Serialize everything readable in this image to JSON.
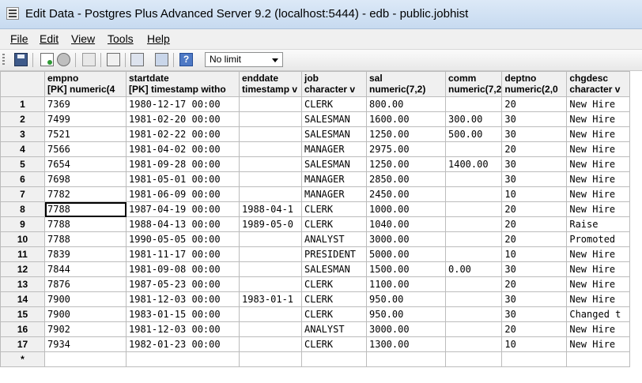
{
  "window": {
    "title": "Edit Data - Postgres Plus Advanced Server 9.2 (localhost:5444) - edb - public.jobhist"
  },
  "menu": [
    {
      "label": "File"
    },
    {
      "label": "Edit"
    },
    {
      "label": "View"
    },
    {
      "label": "Tools"
    },
    {
      "label": "Help"
    }
  ],
  "toolbar": {
    "icons": [
      "save-icon",
      "add-row-icon",
      "refresh-icon",
      "copy-icon",
      "paste-icon",
      "delete-icon",
      "sort-icon",
      "filter-icon",
      "help-icon"
    ],
    "limit_value": "No limit"
  },
  "grid": {
    "columns": [
      {
        "name": "empno",
        "type": "[PK] numeric(4"
      },
      {
        "name": "startdate",
        "type": "[PK] timestamp witho"
      },
      {
        "name": "enddate",
        "type": "timestamp v"
      },
      {
        "name": "job",
        "type": "character v"
      },
      {
        "name": "sal",
        "type": "numeric(7,2)"
      },
      {
        "name": "comm",
        "type": "numeric(7,2"
      },
      {
        "name": "deptno",
        "type": "numeric(2,0"
      },
      {
        "name": "chgdesc",
        "type": "character v"
      }
    ],
    "rows": [
      {
        "num": "1",
        "cells": [
          "7369",
          "1980-12-17 00:00",
          "",
          "CLERK",
          "800.00",
          "",
          "20",
          "New Hire"
        ]
      },
      {
        "num": "2",
        "cells": [
          "7499",
          "1981-02-20 00:00",
          "",
          "SALESMAN",
          "1600.00",
          "300.00",
          "30",
          "New Hire"
        ]
      },
      {
        "num": "3",
        "cells": [
          "7521",
          "1981-02-22 00:00",
          "",
          "SALESMAN",
          "1250.00",
          "500.00",
          "30",
          "New Hire"
        ]
      },
      {
        "num": "4",
        "cells": [
          "7566",
          "1981-04-02 00:00",
          "",
          "MANAGER",
          "2975.00",
          "",
          "20",
          "New Hire"
        ]
      },
      {
        "num": "5",
        "cells": [
          "7654",
          "1981-09-28 00:00",
          "",
          "SALESMAN",
          "1250.00",
          "1400.00",
          "30",
          "New Hire"
        ]
      },
      {
        "num": "6",
        "cells": [
          "7698",
          "1981-05-01 00:00",
          "",
          "MANAGER",
          "2850.00",
          "",
          "30",
          "New Hire"
        ]
      },
      {
        "num": "7",
        "cells": [
          "7782",
          "1981-06-09 00:00",
          "",
          "MANAGER",
          "2450.00",
          "",
          "10",
          "New Hire"
        ]
      },
      {
        "num": "8",
        "cells": [
          "7788",
          "1987-04-19 00:00",
          "1988-04-1",
          "CLERK",
          "1000.00",
          "",
          "20",
          "New Hire"
        ]
      },
      {
        "num": "9",
        "cells": [
          "7788",
          "1988-04-13 00:00",
          "1989-05-0",
          "CLERK",
          "1040.00",
          "",
          "20",
          "Raise"
        ]
      },
      {
        "num": "10",
        "cells": [
          "7788",
          "1990-05-05 00:00",
          "",
          "ANALYST",
          "3000.00",
          "",
          "20",
          "Promoted"
        ]
      },
      {
        "num": "11",
        "cells": [
          "7839",
          "1981-11-17 00:00",
          "",
          "PRESIDENT",
          "5000.00",
          "",
          "10",
          "New Hire"
        ]
      },
      {
        "num": "12",
        "cells": [
          "7844",
          "1981-09-08 00:00",
          "",
          "SALESMAN",
          "1500.00",
          "0.00",
          "30",
          "New Hire"
        ]
      },
      {
        "num": "13",
        "cells": [
          "7876",
          "1987-05-23 00:00",
          "",
          "CLERK",
          "1100.00",
          "",
          "20",
          "New Hire"
        ]
      },
      {
        "num": "14",
        "cells": [
          "7900",
          "1981-12-03 00:00",
          "1983-01-1",
          "CLERK",
          "950.00",
          "",
          "30",
          "New Hire"
        ]
      },
      {
        "num": "15",
        "cells": [
          "7900",
          "1983-01-15 00:00",
          "",
          "CLERK",
          "950.00",
          "",
          "30",
          "Changed t"
        ]
      },
      {
        "num": "16",
        "cells": [
          "7902",
          "1981-12-03 00:00",
          "",
          "ANALYST",
          "3000.00",
          "",
          "20",
          "New Hire"
        ]
      },
      {
        "num": "17",
        "cells": [
          "7934",
          "1982-01-23 00:00",
          "",
          "CLERK",
          "1300.00",
          "",
          "10",
          "New Hire"
        ]
      }
    ],
    "new_row_marker": "*",
    "selected": {
      "row": 7,
      "col": 0
    }
  }
}
